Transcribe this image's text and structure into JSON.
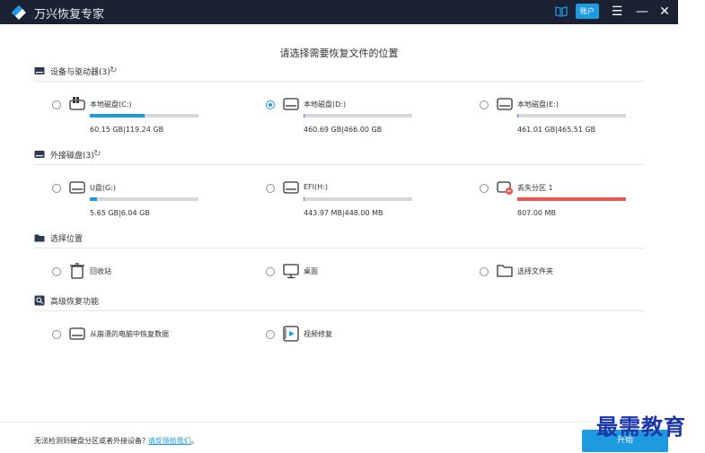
{
  "app": {
    "title": "万兴恢复专家",
    "account_label": "账户",
    "menu_glyph": "☰",
    "minimize_glyph": "—",
    "close_glyph": "✕"
  },
  "heading": "请选择需要恢复文件的位置",
  "sections": {
    "devices": {
      "label": "设备与驱动器(3)",
      "items": [
        {
          "label": "本地磁盘(C:)",
          "size": "60.15  GB|119.24  GB",
          "used_fraction": 0.504,
          "checked": false,
          "icon": "windows-drive-icon"
        },
        {
          "label": "本地磁盘(D:)",
          "size": "460.69  GB|466.00  GB",
          "used_fraction": 0.011,
          "checked": true,
          "icon": "drive-icon"
        },
        {
          "label": "本地磁盘(E:)",
          "size": "461.01  GB|465.51  GB",
          "used_fraction": 0.01,
          "checked": false,
          "icon": "drive-icon"
        }
      ]
    },
    "external": {
      "label": "外接磁盘(3)",
      "items": [
        {
          "label": "U盘(G:)",
          "size": "5.65  GB|6.04  GB",
          "used_fraction": 0.065,
          "checked": false,
          "icon": "drive-icon"
        },
        {
          "label": "EFI(H:)",
          "size": "443.97  MB|448.00  MB",
          "used_fraction": 0.01,
          "checked": false,
          "icon": "drive-icon"
        },
        {
          "label": "丢失分区 1",
          "size": "807.00  MB",
          "used_fraction": 1.0,
          "checked": false,
          "icon": "lost-partition-icon"
        }
      ]
    },
    "locations": {
      "label": "选择位置",
      "items": [
        {
          "label": "回收站",
          "icon": "recycle-bin-icon"
        },
        {
          "label": "桌面",
          "icon": "desktop-icon"
        },
        {
          "label": "选择文件夹",
          "icon": "folder-icon"
        }
      ]
    },
    "advanced": {
      "label": "高级恢复功能",
      "items": [
        {
          "label": "从崩溃的电脑中恢复数据",
          "icon": "crashed-pc-icon"
        },
        {
          "label": "视频修复",
          "icon": "video-repair-icon"
        }
      ]
    }
  },
  "footer": {
    "text": "无法检测到硬盘分区或者外接设备?",
    "link": "请反馈给我们",
    "period": "。",
    "start_label": "开始"
  },
  "watermark": "最需教育",
  "colors": {
    "titlebar": "#1a2233",
    "accent": "#1e9be0",
    "lost_bar": "#e85a4f",
    "bar_track": "#d7d7d7"
  }
}
